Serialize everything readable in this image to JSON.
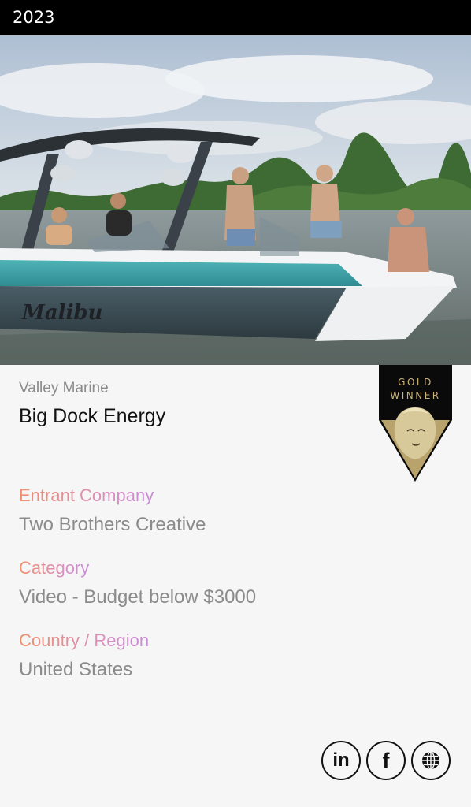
{
  "header": {
    "year": "2023"
  },
  "hero": {
    "image_alt": "Malibu wake boat with passengers on a lake",
    "boat_brand": "Malibu"
  },
  "entry": {
    "client": "Valley Marine",
    "title": "Big Dock Energy"
  },
  "badge": {
    "line1": "GOLD",
    "line2": "WINNER"
  },
  "fields": [
    {
      "label": "Entrant Company",
      "value": "Two Brothers Creative"
    },
    {
      "label": "Category",
      "value": "Video - Budget below $3000"
    },
    {
      "label": "Country / Region",
      "value": "United States"
    }
  ],
  "social": [
    {
      "name": "linkedin",
      "glyph": "in"
    },
    {
      "name": "facebook",
      "glyph": "f"
    },
    {
      "name": "website",
      "icon": "globe-icon"
    }
  ],
  "colors": {
    "label_gradient_start": "#ef8f6a",
    "label_gradient_end": "#c58bd6",
    "value_gray": "#8b8b8b",
    "badge_gold": "#c9b27a"
  }
}
